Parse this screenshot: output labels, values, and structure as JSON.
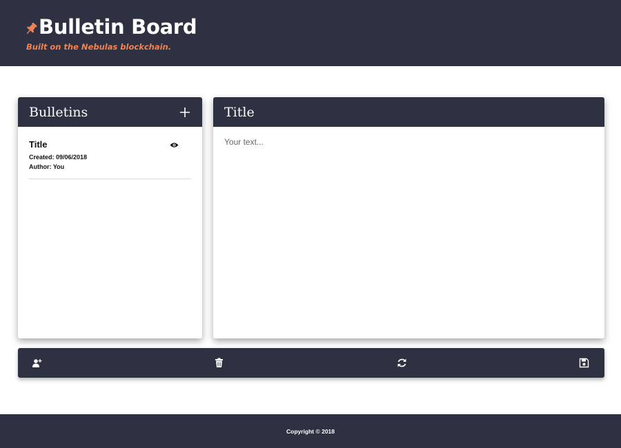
{
  "header": {
    "title": "Bulletin Board",
    "tagline": "Built on the Nebulas blockchain.",
    "logo_icon": "pushpin-icon"
  },
  "bulletins_panel": {
    "title": "Bulletins",
    "add_icon": "plus-icon",
    "items": [
      {
        "title": "Title",
        "created": "Created: 09/06/2018",
        "author": "Author: You",
        "view_icon": "eye-icon"
      }
    ]
  },
  "editor": {
    "title": "Title",
    "body_placeholder": "Your text..."
  },
  "toolbar": {
    "icons": [
      "add-user-icon",
      "trash-icon",
      "refresh-icon",
      "save-icon"
    ]
  },
  "footer": {
    "copyright": "Copyright © 2018"
  },
  "colors": {
    "primary": "#2d3142",
    "accent": "#ef8354",
    "background": "#ffffff"
  }
}
